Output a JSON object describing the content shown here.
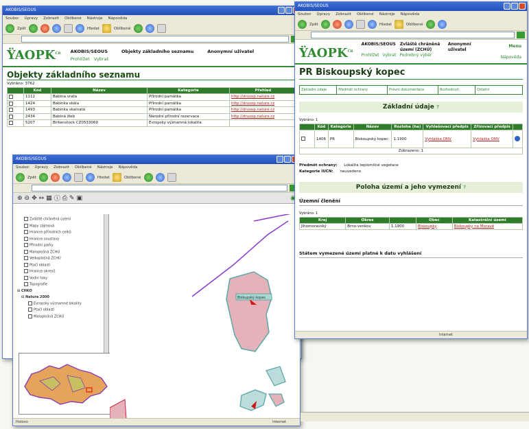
{
  "menu_items": [
    "Soubor",
    "Úpravy",
    "Zobrazit",
    "Oblíbené",
    "Nástroje",
    "Nápověda"
  ],
  "toolbar": {
    "back_label": "Zpět",
    "search_label": "Hledat",
    "favorites_label": "Oblíbené"
  },
  "back_window": {
    "app_name": "AKOBIS/SEOUS",
    "header_title": "Objekty základního seznamu",
    "header_right": "Anonymní uživatel",
    "nav_links": [
      "Prohlížet",
      "Vybrat"
    ],
    "page_heading": "Objekty základního seznamu",
    "result_label": "Vybráno: 3762",
    "columns": [
      "Kód",
      "Název",
      "Kategorie",
      "Přehled"
    ],
    "rows": [
      [
        "1112",
        "Babina vrata",
        "Přírodní památka",
        "http://drusop.nature.cz"
      ],
      [
        "1424",
        "Babinka skála",
        "Přírodní památka",
        "http://drusop.nature.cz"
      ],
      [
        "1493",
        "Babinka skalnatá",
        "Přírodní památka",
        "http://drusop.nature.cz"
      ],
      [
        "2434",
        "Babiná žleb",
        "Národní přírodní rezervace",
        "http://drusop.nature.cz"
      ],
      [
        "5207",
        "Birkenstock CZ0533069",
        "Evropsky významná lokalita",
        ""
      ]
    ]
  },
  "map_window": {
    "status_text": "Hotovo",
    "status_zone": "Internet",
    "layers": [
      "Zvláště chráněná území",
      "Mapy zájmová",
      "Hranice přírodních celků",
      "Hranice soustavy",
      "Přírodní parky",
      "Maloplošná ZCHÚ",
      "Velkoplošná ZCHÚ",
      "Ptačí oblasti",
      "Hranice okresů",
      "Vodní toky",
      "Topografie"
    ],
    "groups": [
      "CHKO",
      "Natura 2000"
    ],
    "sublayers": [
      "Evropsky významné lokality",
      "Ptačí oblasti",
      "Maloplošná ZCHÚ"
    ],
    "polygon_label": "Biskupský kopec"
  },
  "front_window": {
    "app_line1": "AKOBIS/SEOUS",
    "app_line2": "Zvláště chráněná území (ZCHÚ)",
    "user_label": "Anonymní uživatel",
    "nav_links": [
      "Prohlížet",
      "Vybrat",
      "Podrobný výběr"
    ],
    "help_label": "Nápověda",
    "header_right": "Menu",
    "page_title": "PR Biskoupský kopec",
    "tabs": [
      "Základní údaje",
      "Předmět ochrany",
      "Právní dokumentace",
      "Rozhodnutí",
      "Ostatní"
    ],
    "section1": "Základní údaje",
    "result_label": "Vybráno: 1",
    "table_cols": [
      "Kód",
      "Kategorie",
      "Název",
      "Rozloha (ha)",
      "Vyhlašovací předpis",
      "Zřizovací předpis"
    ],
    "table_row": [
      "1406",
      "PR",
      "Biskoupský kopec",
      "1.1900",
      "Vyhláška ONV",
      "Vyhláška ONV"
    ],
    "footer_label": "Zobrazeno: 1",
    "prop_label1": "Předmět ochrany:",
    "prop_value1": "Lokalita teplomilné vegetace",
    "prop_label2": "Kategorie IUCN:",
    "prop_value2": "neuvedeno",
    "section2": "Poloha území a jeho vymezení",
    "subsection": "Územní členění",
    "table2_cols": [
      "Kraj",
      "Okres",
      "Obec",
      "Katastrální území"
    ],
    "table2_row": [
      "Jihomoravský",
      "Brno-venkov",
      "Biskoupky",
      "Biskoupky na Moravě"
    ],
    "footer_text": "Státem vymezené území platné k datu vyhlášení",
    "status_zone": "Internet"
  }
}
